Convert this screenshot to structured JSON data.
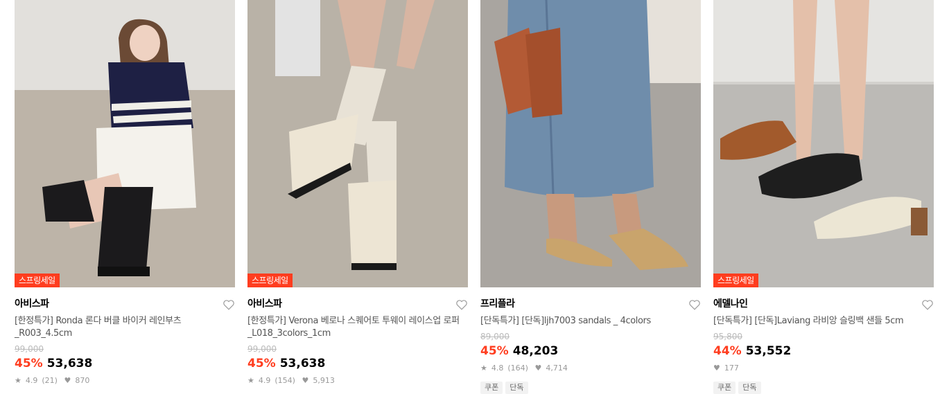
{
  "products": [
    {
      "badge": "스프링세일",
      "brand": "아비스파",
      "name": "[한정특가] Ronda 론다 버클 바이커 레인부츠 _R003_4.5cm",
      "original_price": "99,000",
      "discount": "45%",
      "price": "53,638",
      "rating": "4.9",
      "reviews": "(21)",
      "likes": "870",
      "tags": []
    },
    {
      "badge": "스프링세일",
      "brand": "아비스파",
      "name": "[한정특가] Verona 베로나 스퀘어토 투웨이 레이스업 로퍼 _L018_3colors_1cm",
      "original_price": "99,000",
      "discount": "45%",
      "price": "53,638",
      "rating": "4.9",
      "reviews": "(154)",
      "likes": "5,913",
      "tags": []
    },
    {
      "badge": "",
      "brand": "프리플라",
      "name": "[단독특가] [단독]ljh7003 sandals _ 4colors",
      "original_price": "89,000",
      "discount": "45%",
      "price": "48,203",
      "rating": "4.8",
      "reviews": "(164)",
      "likes": "4,714",
      "tags": [
        "쿠폰",
        "단독"
      ]
    },
    {
      "badge": "스프링세일",
      "brand": "에델나인",
      "name": "[단독특가] [단독]Laviang 라비앙 슬링백 샌들 5cm",
      "original_price": "95,800",
      "discount": "44%",
      "price": "53,552",
      "rating": "",
      "reviews": "",
      "likes": "177",
      "tags": [
        "쿠폰",
        "단독"
      ]
    }
  ]
}
